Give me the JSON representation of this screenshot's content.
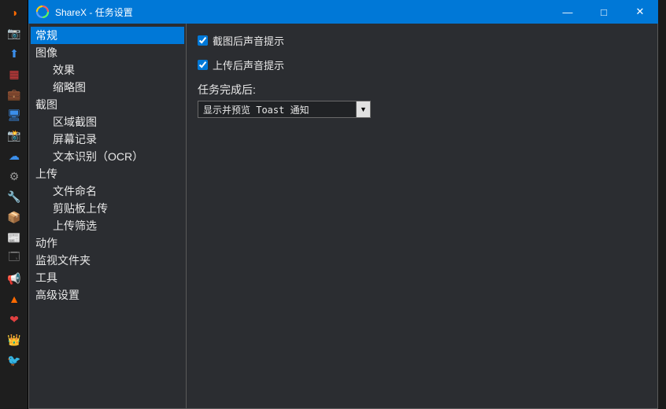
{
  "window": {
    "title": "ShareX - 任务设置",
    "minimize": "—",
    "maximize": "□",
    "close": "✕"
  },
  "leftStrip": [
    {
      "name": "sharex-logo",
      "glyph": "◑",
      "color": "#ff6a00"
    },
    {
      "name": "capture-icon",
      "glyph": "📷",
      "color": "#fff"
    },
    {
      "name": "upload-icon",
      "glyph": "⬆",
      "color": "#3b8eea"
    },
    {
      "name": "grid-icon",
      "glyph": "▦",
      "color": "#e04040"
    },
    {
      "name": "briefcase-icon",
      "glyph": "💼",
      "color": "#d05030"
    },
    {
      "name": "screen-icon",
      "glyph": "🖥",
      "color": "#3b8eea"
    },
    {
      "name": "camera-icon",
      "glyph": "📸",
      "color": "#ccc"
    },
    {
      "name": "cloud-icon",
      "glyph": "☁",
      "color": "#3b8eea"
    },
    {
      "name": "gear-icon",
      "glyph": "⚙",
      "color": "#999"
    },
    {
      "name": "tools-icon",
      "glyph": "🔧",
      "color": "#c89040"
    },
    {
      "name": "box-icon",
      "glyph": "📦",
      "color": "#c89040"
    },
    {
      "name": "news-icon",
      "glyph": "📰",
      "color": "#3b8eea"
    },
    {
      "name": "window-icon",
      "glyph": "🗔",
      "color": "#999"
    },
    {
      "name": "horn-icon",
      "glyph": "📢",
      "color": "#d05030"
    },
    {
      "name": "cone-icon",
      "glyph": "▲",
      "color": "#ff6a00"
    },
    {
      "name": "heart-icon",
      "glyph": "❤",
      "color": "#e04040"
    },
    {
      "name": "crown-icon",
      "glyph": "👑",
      "color": "#f0c040"
    },
    {
      "name": "twitter-icon",
      "glyph": "🐦",
      "color": "#1da1f2"
    }
  ],
  "tree": [
    {
      "label": "常规",
      "selected": true,
      "level": 0
    },
    {
      "label": "图像",
      "level": 0
    },
    {
      "label": "效果",
      "level": 1
    },
    {
      "label": "缩略图",
      "level": 1
    },
    {
      "label": "截图",
      "level": 0
    },
    {
      "label": "区域截图",
      "level": 1
    },
    {
      "label": "屏幕记录",
      "level": 1
    },
    {
      "label": "文本识别（OCR）",
      "level": 1
    },
    {
      "label": "上传",
      "level": 0
    },
    {
      "label": "文件命名",
      "level": 1
    },
    {
      "label": "剪贴板上传",
      "level": 1
    },
    {
      "label": "上传筛选",
      "level": 1
    },
    {
      "label": "动作",
      "level": 0
    },
    {
      "label": "监视文件夹",
      "level": 0
    },
    {
      "label": "工具",
      "level": 0
    },
    {
      "label": "高级设置",
      "level": 0
    }
  ],
  "content": {
    "chk1_label": "截图后声音提示",
    "chk2_label": "上传后声音提示",
    "after_task_label": "任务完成后:",
    "after_task_value": "显示并预览 Toast 通知",
    "dropdown_arrow": "▼"
  }
}
